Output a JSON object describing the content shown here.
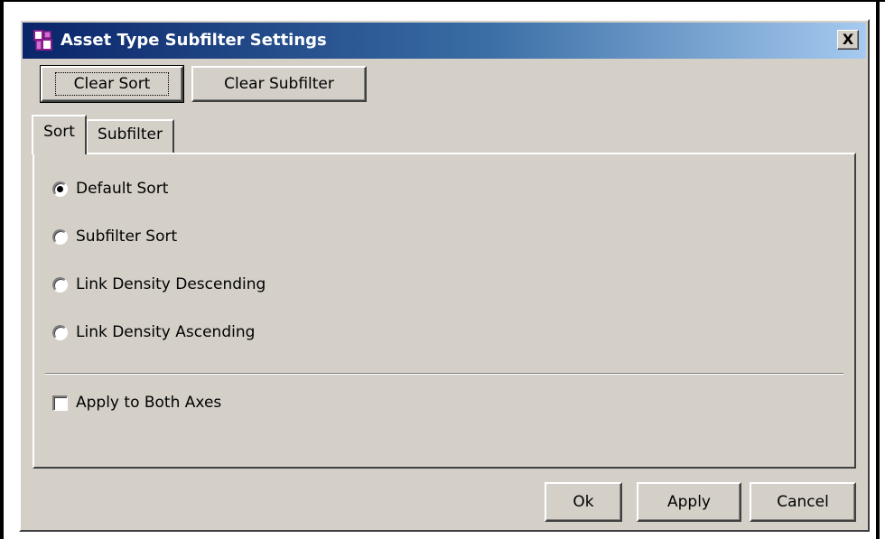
{
  "window": {
    "title": "Asset Type Subfilter Settings",
    "close_label": "X"
  },
  "toolbar": {
    "clear_sort_label": "Clear Sort",
    "clear_subfilter_label": "Clear Subfilter"
  },
  "tabs": [
    {
      "label": "Sort",
      "selected": true
    },
    {
      "label": "Subfilter",
      "selected": false
    }
  ],
  "sort_options": [
    {
      "label": "Default Sort",
      "checked": true
    },
    {
      "label": "Subfilter Sort",
      "checked": false
    },
    {
      "label": "Link Density Descending",
      "checked": false
    },
    {
      "label": "Link Density Ascending",
      "checked": false
    }
  ],
  "apply_both_axes": {
    "label": "Apply to Both Axes",
    "checked": false
  },
  "footer": {
    "ok_label": "Ok",
    "apply_label": "Apply",
    "cancel_label": "Cancel"
  },
  "colors": {
    "dialog_bg": "#d4d0c8",
    "title_gradient_start": "#0a246a",
    "title_gradient_end": "#a6caf0",
    "title_text": "#ffffff"
  },
  "icons": {
    "app": "app-grid-icon",
    "close": "close-icon"
  }
}
